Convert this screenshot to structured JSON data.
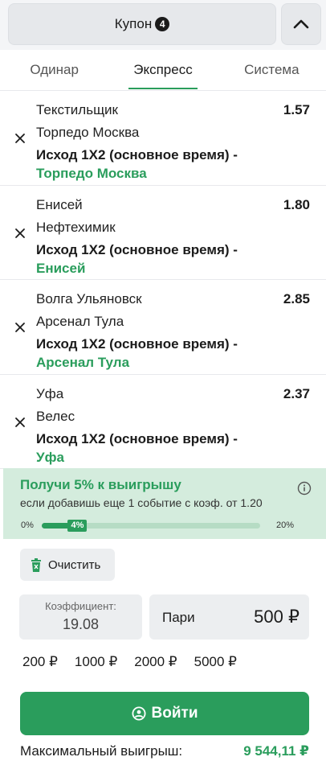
{
  "header": {
    "coupon_label": "Купон",
    "coupon_count": "4",
    "collapse_icon": "chevron-up-icon"
  },
  "tabs": [
    {
      "label": "Одинар",
      "active": false
    },
    {
      "label": "Экспресс",
      "active": true
    },
    {
      "label": "Система",
      "active": false
    }
  ],
  "bets": [
    {
      "team1": "Текстильщик",
      "team2": "Торпедо Москва",
      "odds": "1.57",
      "market": "Исход 1Х2 (основное время) -",
      "pick": "Торпедо Москва"
    },
    {
      "team1": "Енисей",
      "team2": "Нефтехимик",
      "odds": "1.80",
      "market": "Исход 1Х2 (основное время) -",
      "pick": "Енисей"
    },
    {
      "team1": "Волга Ульяновск",
      "team2": "Арсенал Тула",
      "odds": "2.85",
      "market": "Исход 1Х2 (основное время) -",
      "pick": "Арсенал Тула"
    },
    {
      "team1": "Уфа",
      "team2": "Велес",
      "odds": "2.37",
      "market": "Исход 1Х2 (основное время) -",
      "pick": "Уфа"
    }
  ],
  "bonus": {
    "title": "Получи 5% к выигрышу",
    "description": "если добавишь еще 1 событие с коэф. от 1.20",
    "progress_min": "0%",
    "progress_max": "20%",
    "progress_current": "4%",
    "progress_fraction": 0.2
  },
  "controls": {
    "clear_label": "Очистить",
    "coef_label": "Коэффициент:",
    "coef_value": "19.08",
    "stake_label": "Пари",
    "stake_value": "500 ₽",
    "quick_amounts": [
      "200 ₽",
      "1000 ₽",
      "2000 ₽",
      "5000 ₽"
    ]
  },
  "login": {
    "label": "Войти"
  },
  "max_win": {
    "label": "Максимальный выигрыш:",
    "value": "9 544,11 ₽"
  },
  "colors": {
    "accent": "#2a9d5c",
    "bonus_bg": "#d4ecdd",
    "control_bg": "#eceef0"
  }
}
